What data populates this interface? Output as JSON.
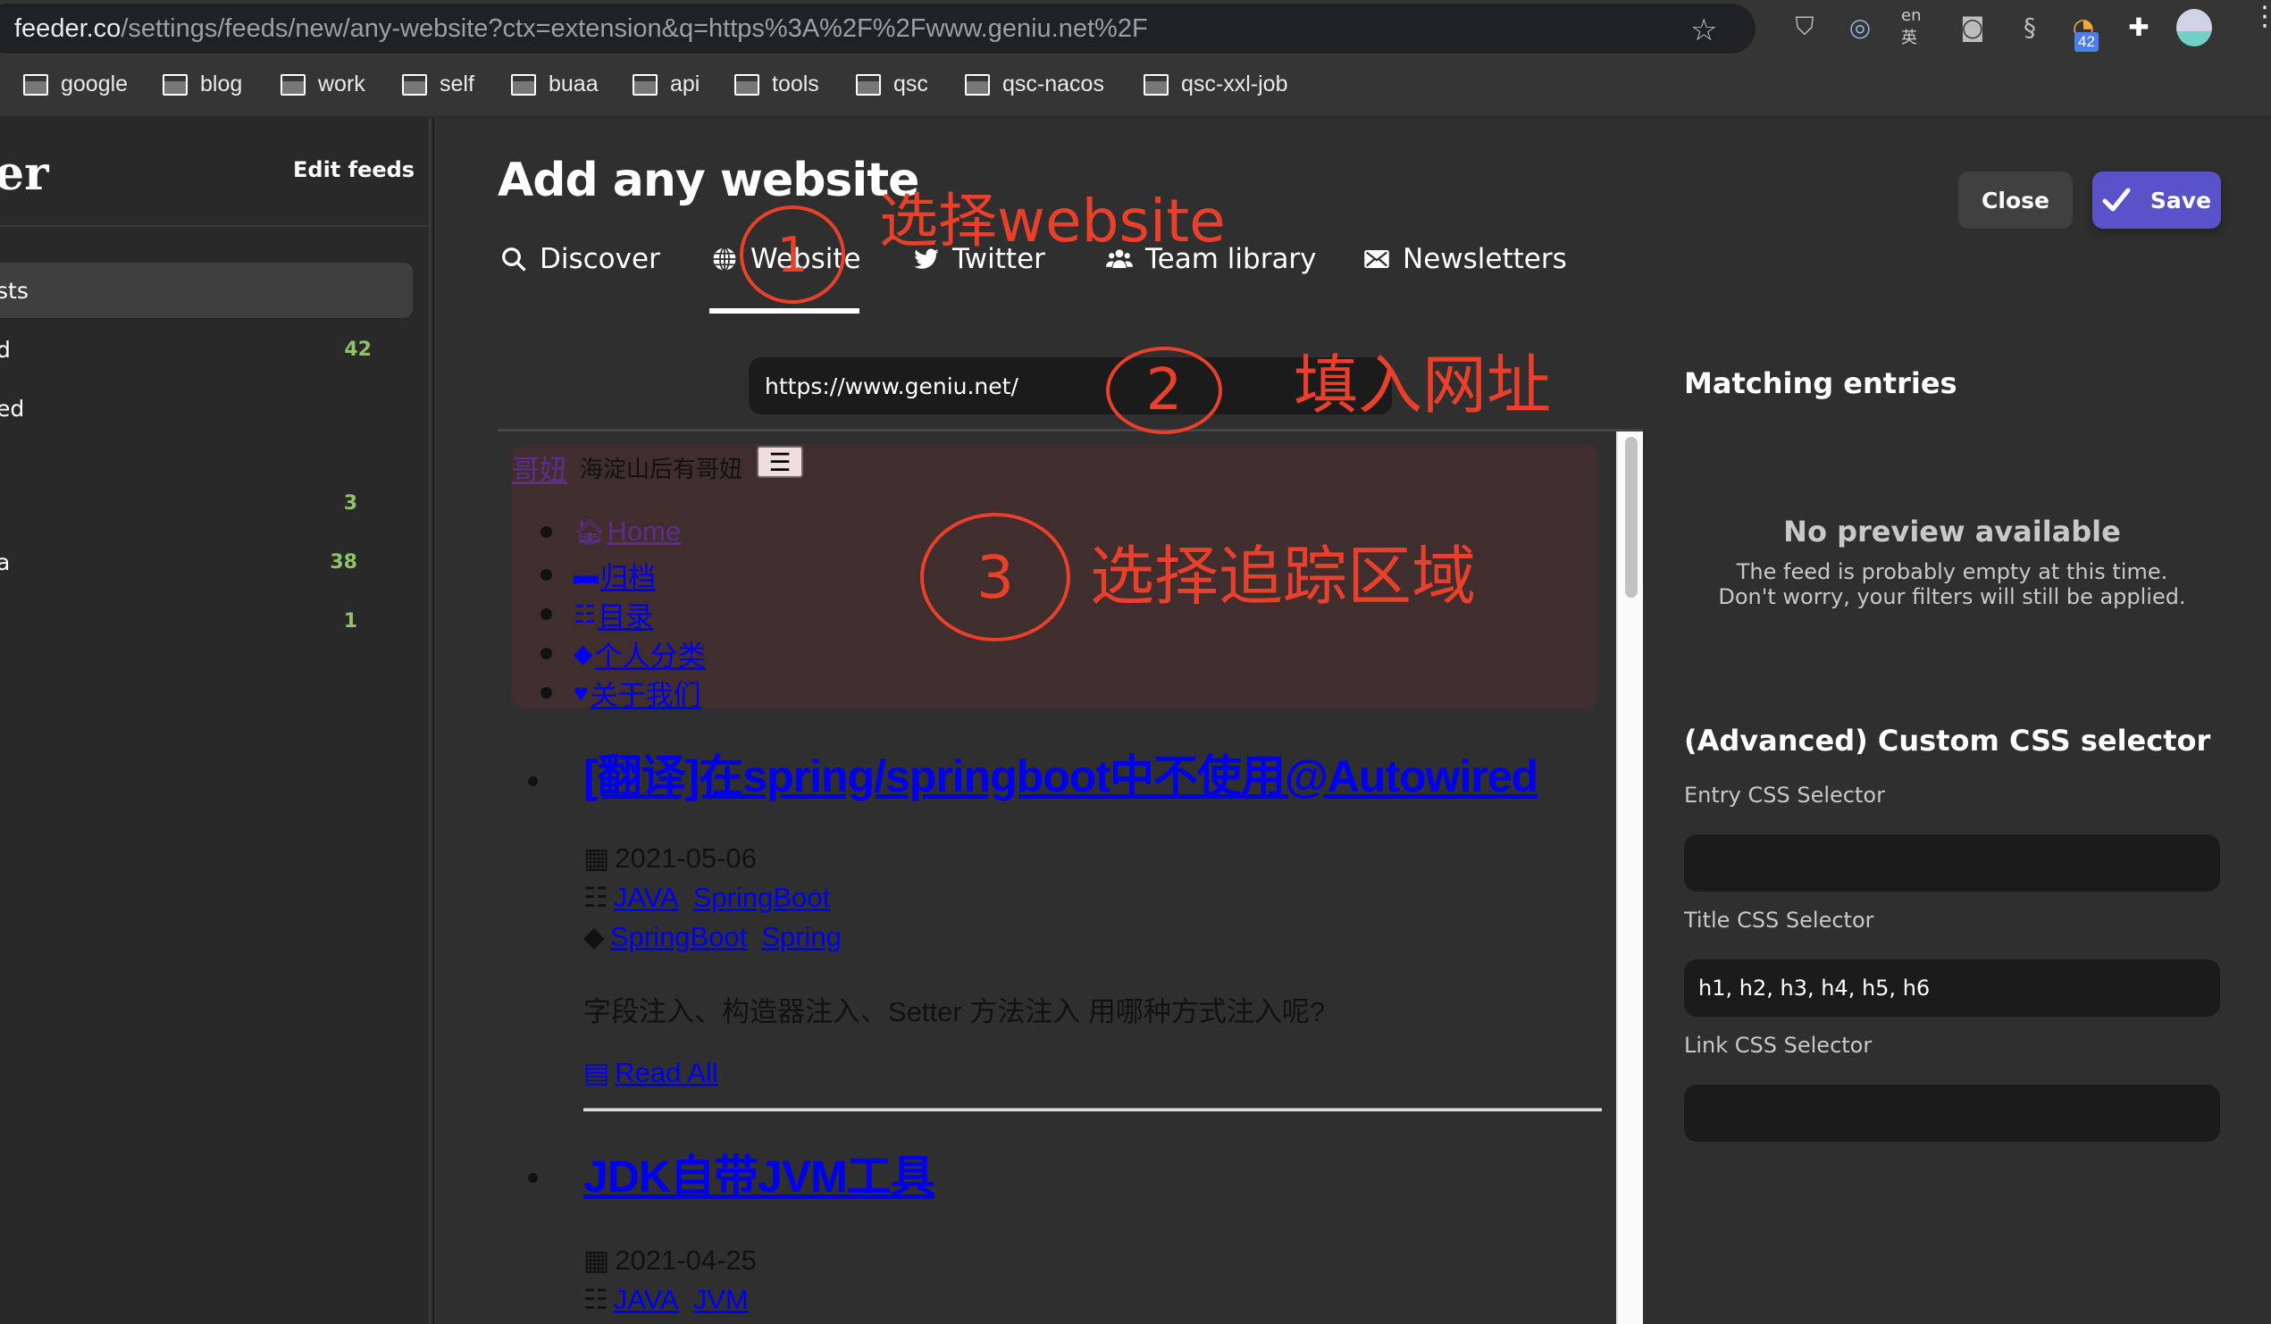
{
  "browser": {
    "url_host": "feeder.co",
    "url_path": "/settings/feeds/new/any-website?ctx=extension&q=https%3A%2F%2Fwww.geniu.net%2F",
    "extensions": [
      "shield-icon",
      "ring-icon",
      "translate-icon",
      "camera-icon",
      "s-logo-icon",
      "rss-icon",
      "puzzle-icon"
    ],
    "rss_badge": "42",
    "bookmarks": [
      "google",
      "blog",
      "work",
      "self",
      "buaa",
      "api",
      "tools",
      "qsc",
      "qsc-nacos",
      "qsc-xxl-job"
    ]
  },
  "sidebar": {
    "logo": "er",
    "edit_feeds": "Edit feeds",
    "items": [
      {
        "label": "sts",
        "count": "",
        "active": true
      },
      {
        "label": "d",
        "count": "42"
      },
      {
        "label": "ed",
        "count": ""
      },
      {
        "label": "",
        "count": "3"
      },
      {
        "label": "a",
        "count": "38"
      },
      {
        "label": "",
        "count": "1"
      }
    ]
  },
  "modal": {
    "title": "Add any website",
    "tabs": [
      {
        "label": "Discover",
        "icon": "search-icon"
      },
      {
        "label": "Website",
        "icon": "globe-icon",
        "active": true
      },
      {
        "label": "Twitter",
        "icon": "twitter-icon"
      },
      {
        "label": "Team library",
        "icon": "users-icon"
      },
      {
        "label": "Newsletters",
        "icon": "envelope-icon"
      }
    ],
    "close_label": "Close",
    "save_label": "Save",
    "url_value": "https://www.geniu.net/"
  },
  "preview": {
    "brand": "哥妞",
    "slogan": "海淀山后有哥妞",
    "hamburger": "☰",
    "nav": [
      {
        "icon": "home-icon",
        "glyph": "🏠︎",
        "label": "Home",
        "visited": true
      },
      {
        "icon": "archive-icon",
        "glyph": "▬",
        "label": "归档"
      },
      {
        "icon": "list-icon",
        "glyph": "☷",
        "label": "目录"
      },
      {
        "icon": "tags-icon",
        "glyph": "◆",
        "label": "个人分类"
      },
      {
        "icon": "heart-icon",
        "glyph": "♥",
        "label": "关于我们"
      }
    ],
    "posts": [
      {
        "title": "[翻译]在spring/springboot中不使用@Autowired",
        "date": "2021-05-06",
        "categories": [
          "JAVA",
          "SpringBoot"
        ],
        "tags": [
          "SpringBoot",
          "Spring"
        ],
        "excerpt": "字段注入、构造器注入、Setter 方法注入 用哪种方式注入呢?",
        "read_all": "Read All"
      },
      {
        "title": "JDK自带JVM工具",
        "date": "2021-04-25",
        "categories": [
          "JAVA",
          "JVM"
        ]
      }
    ]
  },
  "annotations": {
    "step1_number": "1",
    "step1_text": "选择website",
    "step2_number": "2",
    "step2_text": "填入网址",
    "step3_number": "3",
    "step3_text": "选择追踪区域",
    "color": "#e8402a"
  },
  "right_panel": {
    "matching_title": "Matching entries",
    "no_preview_title": "No preview available",
    "no_preview_line1": "The feed is probably empty at this time.",
    "no_preview_line2": "Don't worry, your filters will still be applied.",
    "advanced_title": "(Advanced) Custom CSS selector",
    "entry_label": "Entry CSS Selector",
    "entry_value": "",
    "title_label": "Title CSS Selector",
    "title_value": "h1, h2, h3, h4, h5, h6",
    "link_label": "Link CSS Selector",
    "link_value": ""
  },
  "colors": {
    "save_button": "#5a52c8",
    "count_green": "#8fc36b",
    "link_blue": "#0000ee",
    "visited_purple": "#5f2d8c",
    "annotation_red": "#e8402a"
  }
}
